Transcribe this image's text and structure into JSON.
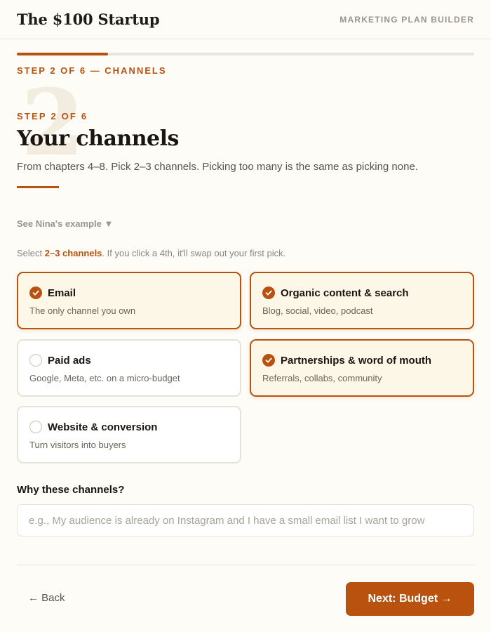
{
  "header": {
    "brand": "The $100 Startup",
    "section": "MARKETING PLAN BUILDER"
  },
  "progress": {
    "fraction": 0.2
  },
  "step_label": "STEP 2 OF 6 — CHANNELS",
  "hero": {
    "number": "2",
    "eyebrow": "STEP 2 OF 6",
    "title": "Your channels",
    "subtitle": "From chapters 4–8. Pick 2–3 channels. Picking too many is the same as picking none."
  },
  "example_toggle": "See Nina's example ▼",
  "select_hint": {
    "prefix": "Select ",
    "emphasis": "2–3 channels",
    "suffix": ". If you click a 4th, it'll swap out your first pick."
  },
  "channels": [
    {
      "title": "Email",
      "desc": "The only channel you own",
      "selected": true
    },
    {
      "title": "Organic content & search",
      "desc": "Blog, social, video, podcast",
      "selected": true
    },
    {
      "title": "Paid ads",
      "desc": "Google, Meta, etc. on a micro-budget",
      "selected": false
    },
    {
      "title": "Partnerships & word of mouth",
      "desc": "Referrals, collabs, community",
      "selected": true
    },
    {
      "title": "Website & conversion",
      "desc": "Turn visitors into buyers",
      "selected": false
    }
  ],
  "why": {
    "label": "Why these channels?",
    "value": "",
    "placeholder": "e.g., My audience is already on Instagram and I have a small email list I want to grow"
  },
  "footer": {
    "back_label": "← Back",
    "next_label": "Next: Budget →"
  },
  "colors": {
    "accent": "#b8520e",
    "background": "#fdfcf6",
    "selected_card": "#fdf7e7"
  }
}
